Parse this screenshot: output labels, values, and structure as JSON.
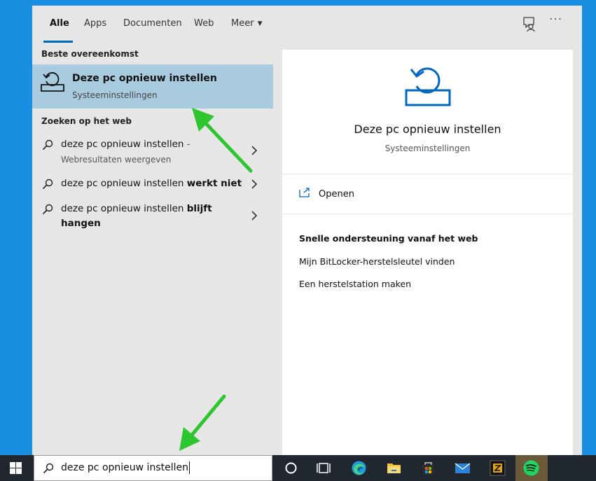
{
  "tabs": [
    {
      "label": "Alle"
    },
    {
      "label": "Apps"
    },
    {
      "label": "Documenten"
    },
    {
      "label": "Web"
    },
    {
      "label": "Meer"
    }
  ],
  "left": {
    "best_match_label": "Beste overeenkomst",
    "best": {
      "title": "Deze pc opnieuw instellen",
      "subtitle": "Systeeminstellingen"
    },
    "web_label": "Zoeken op het web",
    "web_items": [
      {
        "prefix": "deze pc opnieuw instellen",
        "bold": "",
        "suffix": " -",
        "sub": "Webresultaten weergeven"
      },
      {
        "prefix": "deze pc opnieuw instellen ",
        "bold": "werkt niet"
      },
      {
        "prefix": "deze pc opnieuw instellen ",
        "bold": "blijft",
        "bold2": "hangen"
      }
    ]
  },
  "preview": {
    "title": "Deze pc opnieuw instellen",
    "subtitle": "Systeeminstellingen",
    "open_label": "Openen",
    "help_title": "Snelle ondersteuning vanaf het web",
    "links": [
      "Mijn BitLocker-herstelsleutel vinden",
      "Een herstelstation maken"
    ]
  },
  "taskbar": {
    "search_value": "deze pc opnieuw instellen",
    "icons": [
      "cortana-icon",
      "task-view-icon",
      "edge-icon",
      "file-explorer-icon",
      "store-icon",
      "mail-icon",
      "app-icon",
      "spotify-icon"
    ]
  },
  "colors": {
    "accent": "#0067c0",
    "highlight": "#a8cbdf",
    "desktop": "#1a8ee0",
    "taskbar": "#20272e",
    "annotation_arrow": "#2ec62e"
  }
}
